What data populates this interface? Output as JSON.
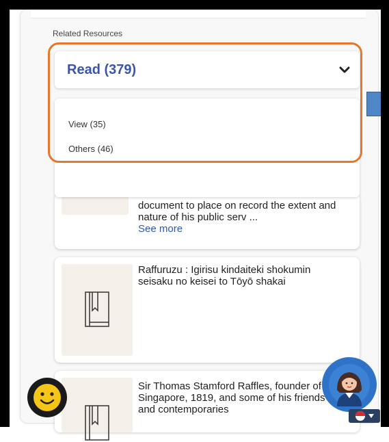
{
  "section": {
    "label": "Related Resources"
  },
  "dropdown": {
    "selected": "Read (379)",
    "options": [
      "View (35)",
      "Others (46)"
    ]
  },
  "cards": [
    {
      "text": "document to place on record the extent and nature of his public serv ...",
      "see_more": "See more"
    },
    {
      "text": "Raffuruzu : Igirisu kindaiteki shokumin seisaku no keisei to Tōyō shakai"
    },
    {
      "text": "Sir Thomas Stamford Raffles, founder of Singapore, 1819, and some of his friends and contemporaries"
    }
  ],
  "colors": {
    "accent": "#3a55a8",
    "highlight": "#e5772d",
    "link": "#2b57b8"
  },
  "icons": [
    "chevron-down-icon",
    "book-icon",
    "smiley-face-icon",
    "assistant-avatar-icon",
    "language-icon"
  ]
}
